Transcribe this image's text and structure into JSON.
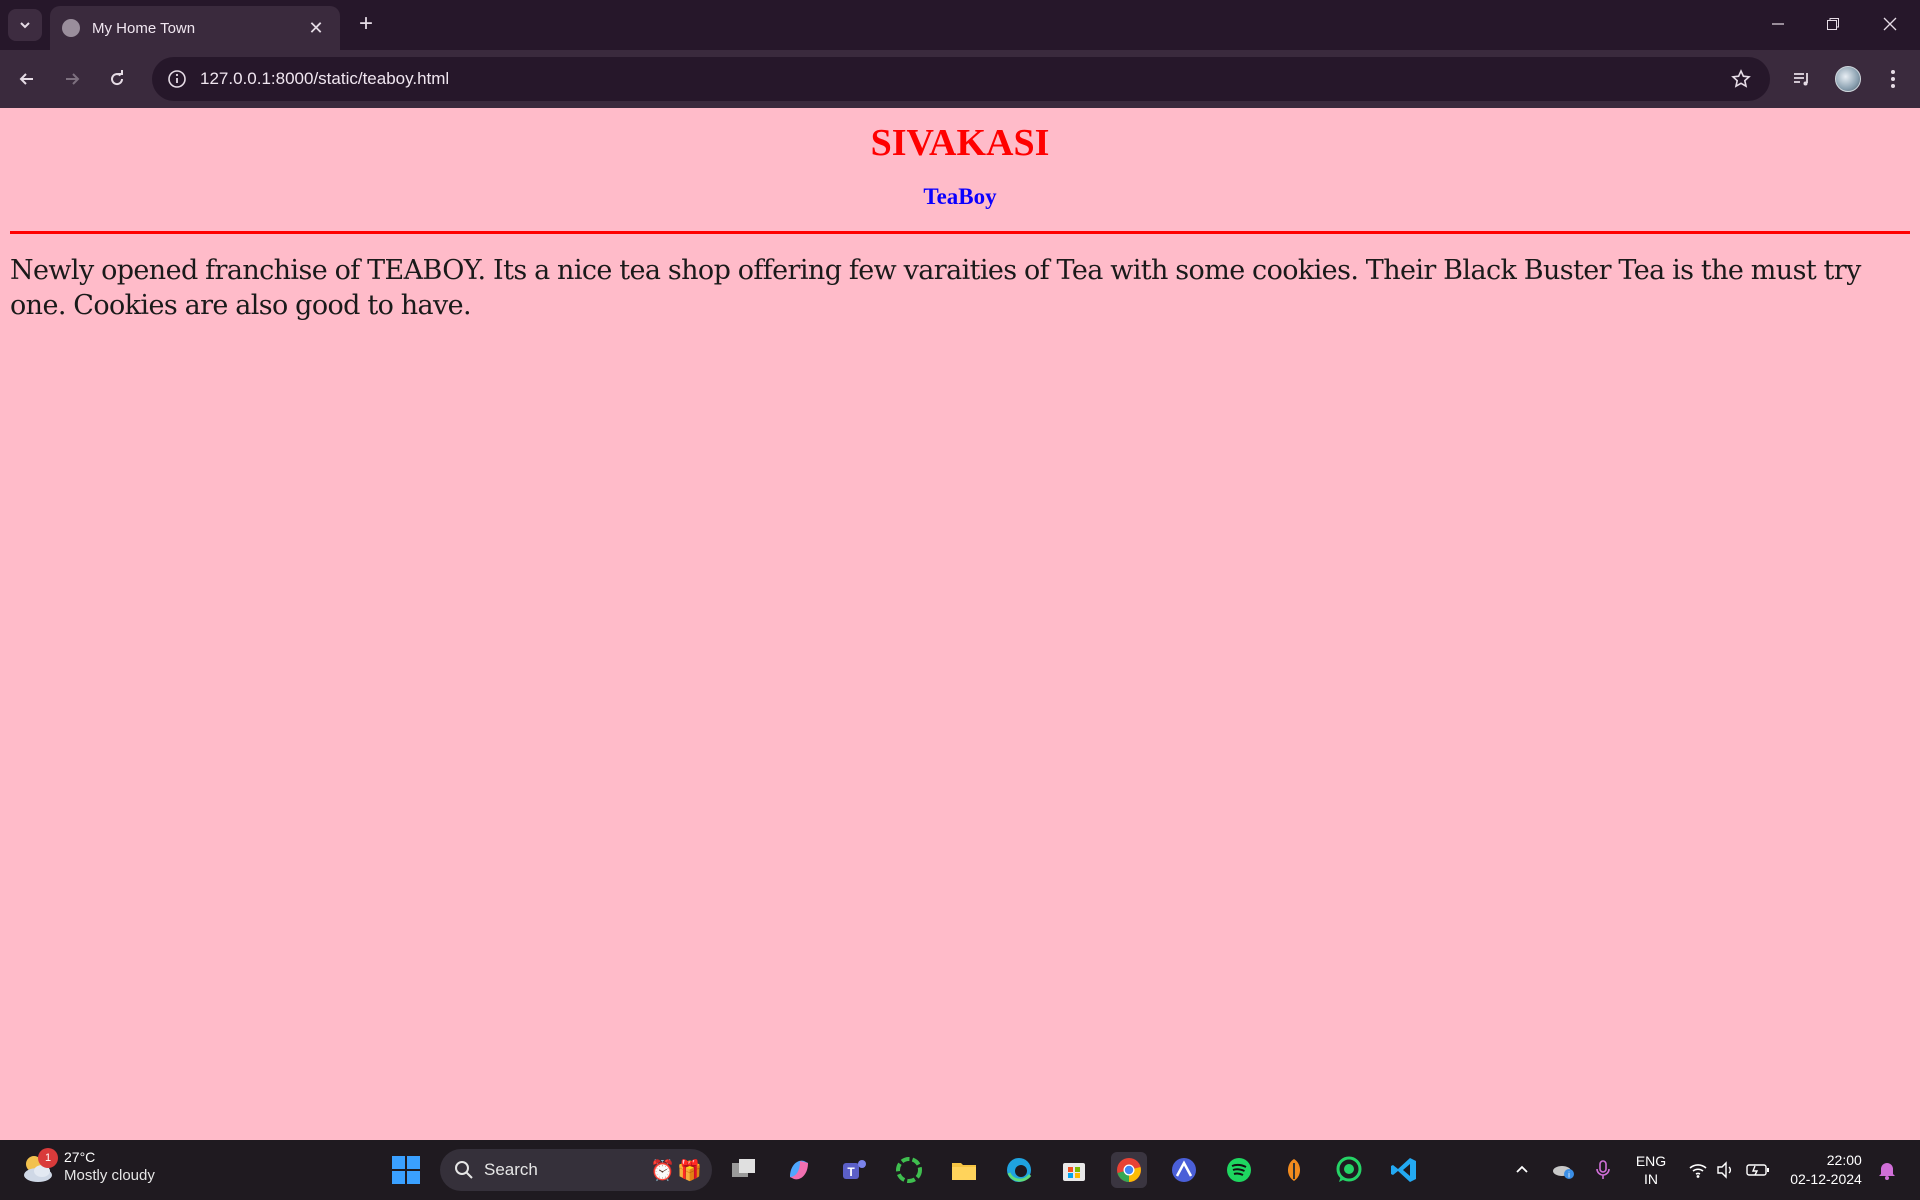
{
  "browser": {
    "tab": {
      "title": "My Home Town"
    },
    "address_bar": {
      "url": "127.0.0.1:8000/static/teaboy.html"
    }
  },
  "page": {
    "title": "SIVAKASI",
    "subtitle": "TeaBoy",
    "body": "Newly opened franchise of TEABOY. Its a nice tea shop offering few varaities of Tea with some cookies. Their Black Buster Tea is the must try one. Cookies are also good to have.",
    "background_color": "#ffbbc9",
    "title_color": "#ff0000",
    "subtitle_color": "#0b00ff"
  },
  "taskbar": {
    "weather": {
      "temp": "27°C",
      "condition": "Mostly cloudy",
      "badge": "1"
    },
    "search": {
      "label": "Search"
    },
    "language": {
      "line1": "ENG",
      "line2": "IN"
    },
    "clock": {
      "time": "22:00",
      "date": "02-12-2024"
    }
  }
}
